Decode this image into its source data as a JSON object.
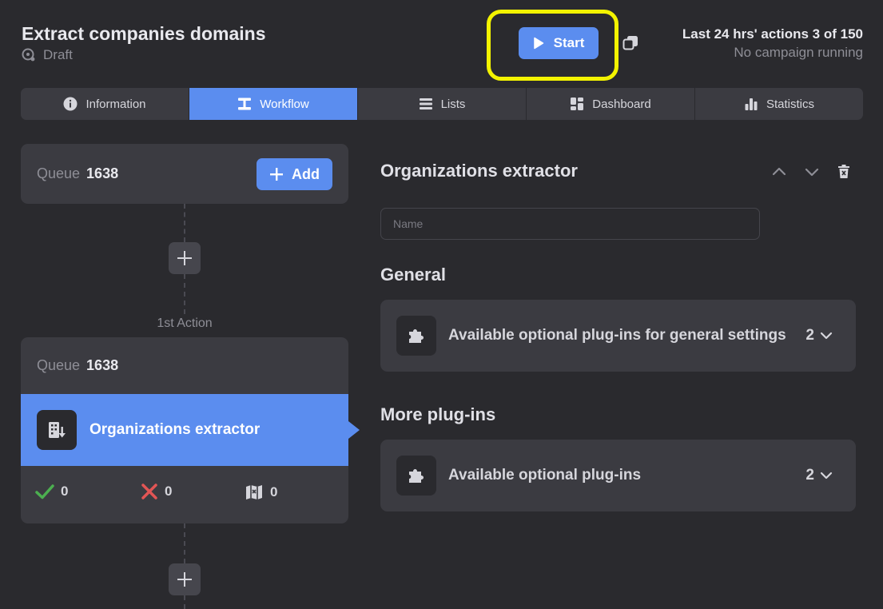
{
  "header": {
    "title": "Extract companies domains",
    "status": "Draft",
    "start_label": "Start",
    "quota_text": "Last 24 hrs' actions 3 of 150",
    "campaign_status": "No campaign running"
  },
  "tabs": [
    {
      "label": "Information",
      "icon": "info-icon"
    },
    {
      "label": "Workflow",
      "icon": "workflow-icon"
    },
    {
      "label": "Lists",
      "icon": "list-icon"
    },
    {
      "label": "Dashboard",
      "icon": "dashboard-icon"
    },
    {
      "label": "Statistics",
      "icon": "bar-chart-icon"
    }
  ],
  "active_tab": "Workflow",
  "workflow": {
    "queue_label": "Queue",
    "queue_count": "1638",
    "add_label": "Add",
    "action_label": "1st Action",
    "action": {
      "queue_label": "Queue",
      "queue_count": "1638",
      "name": "Organizations extractor",
      "success_count": "0",
      "error_count": "0",
      "skipped_count": "0"
    }
  },
  "panel": {
    "title": "Organizations extractor",
    "name_placeholder": "Name",
    "general_title": "General",
    "general_plugins_label": "Available optional plug-ins for general settings",
    "general_plugins_count": "2",
    "more_title": "More plug-ins",
    "more_plugins_label": "Available optional plug-ins",
    "more_plugins_count": "2"
  },
  "colors": {
    "accent": "#5b8def",
    "background": "#2a2a2e",
    "card": "#3b3b41",
    "highlight": "#f3f300",
    "success": "#4caf50",
    "error": "#e25555"
  }
}
